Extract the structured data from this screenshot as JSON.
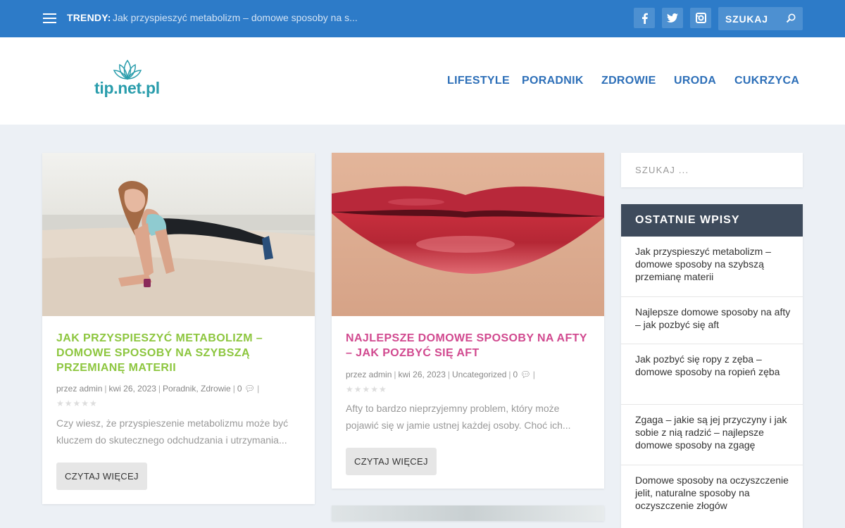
{
  "topbar": {
    "trendy_label": "TRENDY:",
    "trendy_link": "Jak przyspieszyć metabolizm – domowe sposoby na s...",
    "search_label": "SZUKAJ",
    "social": [
      "facebook-icon",
      "twitter-icon",
      "instagram-icon"
    ]
  },
  "header": {
    "logo_text": "tip.net.pl",
    "nav": [
      "LIFESTYLE",
      "PORADNIK",
      "ZDROWIE",
      "URODA",
      "CUKRZYCA"
    ]
  },
  "posts": [
    {
      "title": "JAK PRZYSPIESZYĆ METABOLIZM – DOMOWE SPOSOBY NA SZYBSZĄ PRZEMIANĘ MATERII",
      "title_color": "#8dc63f",
      "meta_by": "przez admin",
      "meta_date": "kwi 26, 2023",
      "meta_cats": "Poradnik, Zdrowie",
      "meta_comments": "0",
      "excerpt": "Czy wiesz, że przyspieszenie metabolizmu może być kluczem do skutecznego odchudzania i utrzymania...",
      "read_more": "CZYTAJ WIĘCEJ"
    },
    {
      "title": "NAJLEPSZE DOMOWE SPOSOBY NA AFTY – JAK POZBYĆ SIĘ AFT",
      "title_color": "#d1498f",
      "meta_by": "przez admin",
      "meta_date": "kwi 26, 2023",
      "meta_cats": "Uncategorized",
      "meta_comments": "0",
      "excerpt": "Afty to bardzo nieprzyjemny problem, który może pojawić się w jamie ustnej każdej osoby. Choć ich...",
      "read_more": "CZYTAJ WIĘCEJ"
    }
  ],
  "sidebar": {
    "search_placeholder": "SZUKAJ ...",
    "recent_title": "OSTATNIE WPISY",
    "recent": [
      "Jak przyspieszyć metabolizm – domowe sposoby na szybszą przemianę materii",
      "Najlepsze domowe sposoby na afty – jak pozbyć się aft",
      "Jak pozbyć się ropy z zęba – domowe sposoby na ropień zęba",
      "Zgaga – jakie są jej przyczyny i jak sobie z nią radzić – najlepsze domowe sposoby na zgagę",
      "Domowe sposoby na oczyszczenie jelit, naturalne sposoby na oczyszczenie złogów"
    ]
  }
}
